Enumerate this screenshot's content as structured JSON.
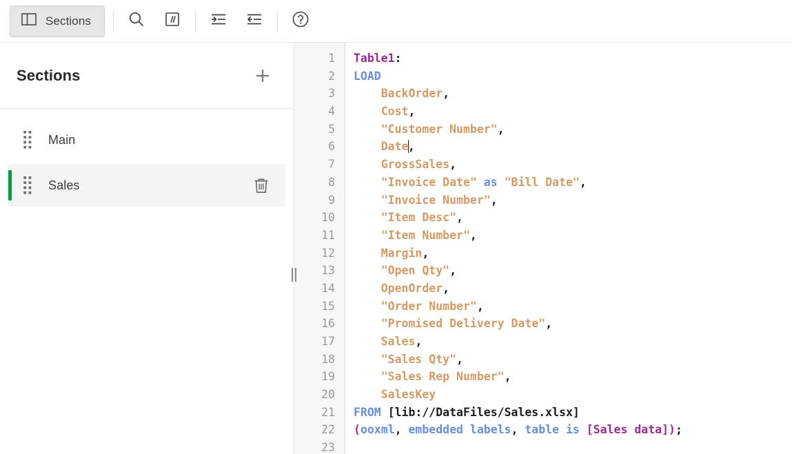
{
  "toolbar": {
    "sections_button": {
      "label": "Sections",
      "icon": "panel-layout-icon"
    },
    "buttons": [
      {
        "name": "search",
        "icon": "search-icon"
      },
      {
        "name": "comment",
        "icon": "comment-slashes-icon"
      },
      {
        "name": "indent",
        "icon": "indent-increase-icon"
      },
      {
        "name": "outdent",
        "icon": "indent-decrease-icon"
      },
      {
        "name": "help",
        "icon": "help-circle-icon"
      }
    ]
  },
  "sidebar": {
    "title": "Sections",
    "add_label": "+",
    "accent_color": "#009845",
    "items": [
      {
        "label": "Main",
        "selected": false
      },
      {
        "label": "Sales",
        "selected": true
      }
    ]
  },
  "editor": {
    "line_numbers": [
      "1",
      "2",
      "3",
      "4",
      "5",
      "6",
      "7",
      "8",
      "9",
      "10",
      "11",
      "12",
      "13",
      "14",
      "15",
      "16",
      "17",
      "18",
      "19",
      "20",
      "21",
      "22",
      "23"
    ],
    "cursor_line": 6,
    "cursor_column": 9,
    "colors": {
      "table_label": "#9b2a8f",
      "keyword": "#6a8dd6",
      "field": "#d19a66",
      "punctuation": "#1c1c1c",
      "bracket": "#9b2a8f",
      "gutter_text": "#9a9a9a",
      "gutter_bg": "#f7f7f7"
    },
    "lines": [
      {
        "n": 1,
        "tokens": [
          {
            "t": "Table1",
            "c": "table"
          },
          {
            "t": ":",
            "c": "punct"
          }
        ]
      },
      {
        "n": 2,
        "tokens": [
          {
            "t": "LOAD",
            "c": "kw"
          }
        ]
      },
      {
        "n": 3,
        "tokens": [
          {
            "t": "    ",
            "c": "plain"
          },
          {
            "t": "BackOrder",
            "c": "field"
          },
          {
            "t": ",",
            "c": "punct"
          }
        ]
      },
      {
        "n": 4,
        "tokens": [
          {
            "t": "    ",
            "c": "plain"
          },
          {
            "t": "Cost",
            "c": "field"
          },
          {
            "t": ",",
            "c": "punct"
          }
        ]
      },
      {
        "n": 5,
        "tokens": [
          {
            "t": "    ",
            "c": "plain"
          },
          {
            "t": "\"Customer Number\"",
            "c": "field"
          },
          {
            "t": ",",
            "c": "punct"
          }
        ]
      },
      {
        "n": 6,
        "tokens": [
          {
            "t": "    ",
            "c": "plain"
          },
          {
            "t": "Date",
            "c": "field"
          },
          {
            "t": "|CARET|",
            "c": "caret"
          },
          {
            "t": ",",
            "c": "punct"
          }
        ]
      },
      {
        "n": 7,
        "tokens": [
          {
            "t": "    ",
            "c": "plain"
          },
          {
            "t": "GrossSales",
            "c": "field"
          },
          {
            "t": ",",
            "c": "punct"
          }
        ]
      },
      {
        "n": 8,
        "tokens": [
          {
            "t": "    ",
            "c": "plain"
          },
          {
            "t": "\"Invoice Date\"",
            "c": "field"
          },
          {
            "t": " ",
            "c": "plain"
          },
          {
            "t": "as",
            "c": "kw"
          },
          {
            "t": " ",
            "c": "plain"
          },
          {
            "t": "\"Bill Date\"",
            "c": "field"
          },
          {
            "t": ",",
            "c": "punct"
          }
        ]
      },
      {
        "n": 9,
        "tokens": [
          {
            "t": "    ",
            "c": "plain"
          },
          {
            "t": "\"Invoice Number\"",
            "c": "field"
          },
          {
            "t": ",",
            "c": "punct"
          }
        ]
      },
      {
        "n": 10,
        "tokens": [
          {
            "t": "    ",
            "c": "plain"
          },
          {
            "t": "\"Item Desc\"",
            "c": "field"
          },
          {
            "t": ",",
            "c": "punct"
          }
        ]
      },
      {
        "n": 11,
        "tokens": [
          {
            "t": "    ",
            "c": "plain"
          },
          {
            "t": "\"Item Number\"",
            "c": "field"
          },
          {
            "t": ",",
            "c": "punct"
          }
        ]
      },
      {
        "n": 12,
        "tokens": [
          {
            "t": "    ",
            "c": "plain"
          },
          {
            "t": "Margin",
            "c": "field"
          },
          {
            "t": ",",
            "c": "punct"
          }
        ]
      },
      {
        "n": 13,
        "tokens": [
          {
            "t": "    ",
            "c": "plain"
          },
          {
            "t": "\"Open Qty\"",
            "c": "field"
          },
          {
            "t": ",",
            "c": "punct"
          }
        ]
      },
      {
        "n": 14,
        "tokens": [
          {
            "t": "    ",
            "c": "plain"
          },
          {
            "t": "OpenOrder",
            "c": "field"
          },
          {
            "t": ",",
            "c": "punct"
          }
        ]
      },
      {
        "n": 15,
        "tokens": [
          {
            "t": "    ",
            "c": "plain"
          },
          {
            "t": "\"Order Number\"",
            "c": "field"
          },
          {
            "t": ",",
            "c": "punct"
          }
        ]
      },
      {
        "n": 16,
        "tokens": [
          {
            "t": "    ",
            "c": "plain"
          },
          {
            "t": "\"Promised Delivery Date\"",
            "c": "field"
          },
          {
            "t": ",",
            "c": "punct"
          }
        ]
      },
      {
        "n": 17,
        "tokens": [
          {
            "t": "    ",
            "c": "plain"
          },
          {
            "t": "Sales",
            "c": "field"
          },
          {
            "t": ",",
            "c": "punct"
          }
        ]
      },
      {
        "n": 18,
        "tokens": [
          {
            "t": "    ",
            "c": "plain"
          },
          {
            "t": "\"Sales Qty\"",
            "c": "field"
          },
          {
            "t": ",",
            "c": "punct"
          }
        ]
      },
      {
        "n": 19,
        "tokens": [
          {
            "t": "    ",
            "c": "plain"
          },
          {
            "t": "\"Sales Rep Number\"",
            "c": "field"
          },
          {
            "t": ",",
            "c": "punct"
          }
        ]
      },
      {
        "n": 20,
        "tokens": [
          {
            "t": "    ",
            "c": "plain"
          },
          {
            "t": "SalesKey",
            "c": "field"
          }
        ]
      },
      {
        "n": 21,
        "tokens": [
          {
            "t": "FROM",
            "c": "kw"
          },
          {
            "t": " ",
            "c": "plain"
          },
          {
            "t": "[lib://DataFiles/Sales.xlsx]",
            "c": "plain"
          }
        ]
      },
      {
        "n": 22,
        "tokens": [
          {
            "t": "(",
            "c": "bracket"
          },
          {
            "t": "ooxml",
            "c": "kw"
          },
          {
            "t": ",",
            "c": "punct"
          },
          {
            "t": " ",
            "c": "plain"
          },
          {
            "t": "embedded labels",
            "c": "kw"
          },
          {
            "t": ",",
            "c": "punct"
          },
          {
            "t": " ",
            "c": "plain"
          },
          {
            "t": "table is",
            "c": "kw"
          },
          {
            "t": " ",
            "c": "plain"
          },
          {
            "t": "[Sales data]",
            "c": "bracket"
          },
          {
            "t": ")",
            "c": "bracket"
          },
          {
            "t": ";",
            "c": "punct"
          }
        ]
      },
      {
        "n": 23,
        "tokens": []
      }
    ]
  }
}
